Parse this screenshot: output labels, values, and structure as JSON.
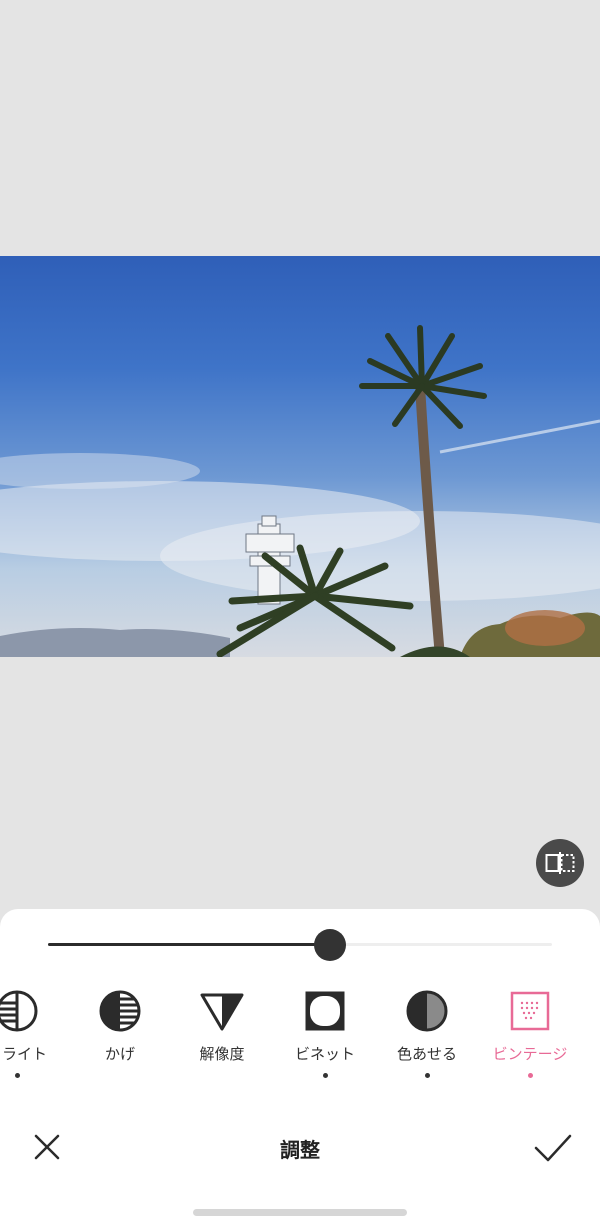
{
  "photo": {
    "subject": "palm-trees-and-lighthouse"
  },
  "compare": {
    "icon": "compare-split-icon"
  },
  "slider": {
    "value": 0.56
  },
  "tools": [
    {
      "id": "highlight",
      "label": "イライト",
      "icon": "highlight-icon",
      "dot": true,
      "active": false
    },
    {
      "id": "shadow",
      "label": "かげ",
      "icon": "shadow-icon",
      "dot": false,
      "active": false
    },
    {
      "id": "sharpness",
      "label": "解像度",
      "icon": "sharpness-icon",
      "dot": false,
      "active": false
    },
    {
      "id": "vignette",
      "label": "ビネット",
      "icon": "vignette-icon",
      "dot": true,
      "active": false
    },
    {
      "id": "fade",
      "label": "色あせる",
      "icon": "fade-icon",
      "dot": true,
      "active": false
    },
    {
      "id": "vintage",
      "label": "ビンテージ",
      "icon": "vintage-icon",
      "dot": true,
      "active": true
    }
  ],
  "bottom": {
    "title": "調整",
    "close_icon": "close-icon",
    "confirm_icon": "checkmark-icon"
  },
  "colors": {
    "accent": "#e86a96",
    "dot": "#333333",
    "panel": "#ffffff",
    "canvas": "#e4e4e4"
  }
}
